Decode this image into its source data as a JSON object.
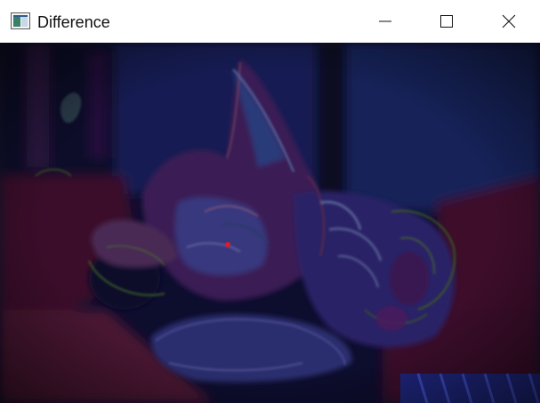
{
  "window": {
    "title": "Difference",
    "controls": {
      "minimize": "minimize-icon",
      "maximize": "maximize-icon",
      "close": "close-icon"
    }
  },
  "image": {
    "content": "difference-image-of-sleeping-cat",
    "colors": {
      "base": "#0d0d2e",
      "blue": "#1a2566",
      "magenta": "#5a1438",
      "red_marker": "#e01a2a",
      "green_edge": "#3a5a28"
    }
  }
}
